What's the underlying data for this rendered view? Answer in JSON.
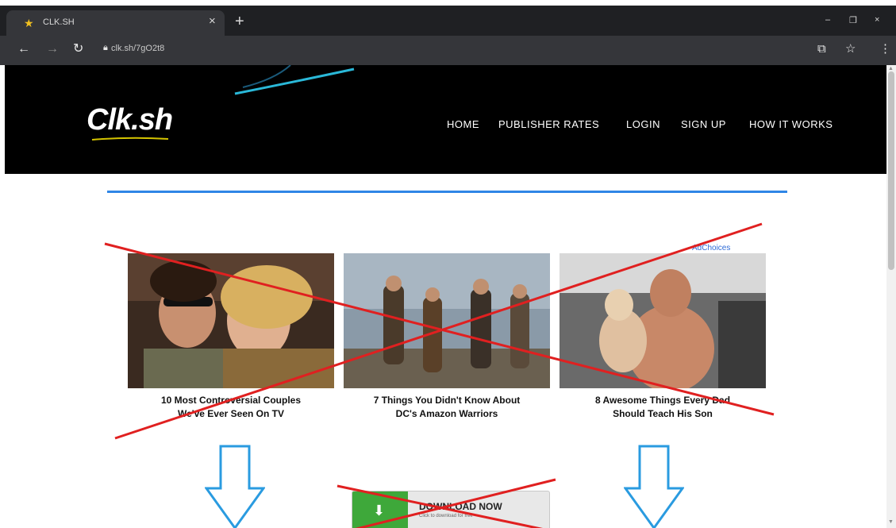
{
  "browser": {
    "tab_title": "CLK.SH",
    "favicon": "clksh-star-icon",
    "url": "clk.sh/7gO2t8",
    "new_tab": "+",
    "close": "×",
    "window_controls": [
      "–",
      "❐",
      "×"
    ]
  },
  "site": {
    "logo": "Clk.sh",
    "nav": [
      "HOME",
      "PUBLISHER RATES",
      "LOGIN",
      "SIGN UP",
      "HOW IT WORKS"
    ]
  },
  "ad": {
    "adchoices": "AdChoices",
    "cards": [
      {
        "caption_line1": "10 Most Controversial Couples",
        "caption_line2": "We've Ever Seen On TV"
      },
      {
        "caption_line1": "7 Things You Didn't Know About",
        "caption_line2": "DC's Amazon Warriors"
      },
      {
        "caption_line1": "8 Awesome Things Every Dad",
        "caption_line2": "Should Teach His Son"
      }
    ],
    "download_label": "DOWNLOAD NOW",
    "download_sub": "Click to download for free"
  },
  "colors": {
    "accent_line": "#2f86e6",
    "cross": "#e02020",
    "arrow": "#2a9be0",
    "download_green": "#3ea83a"
  }
}
